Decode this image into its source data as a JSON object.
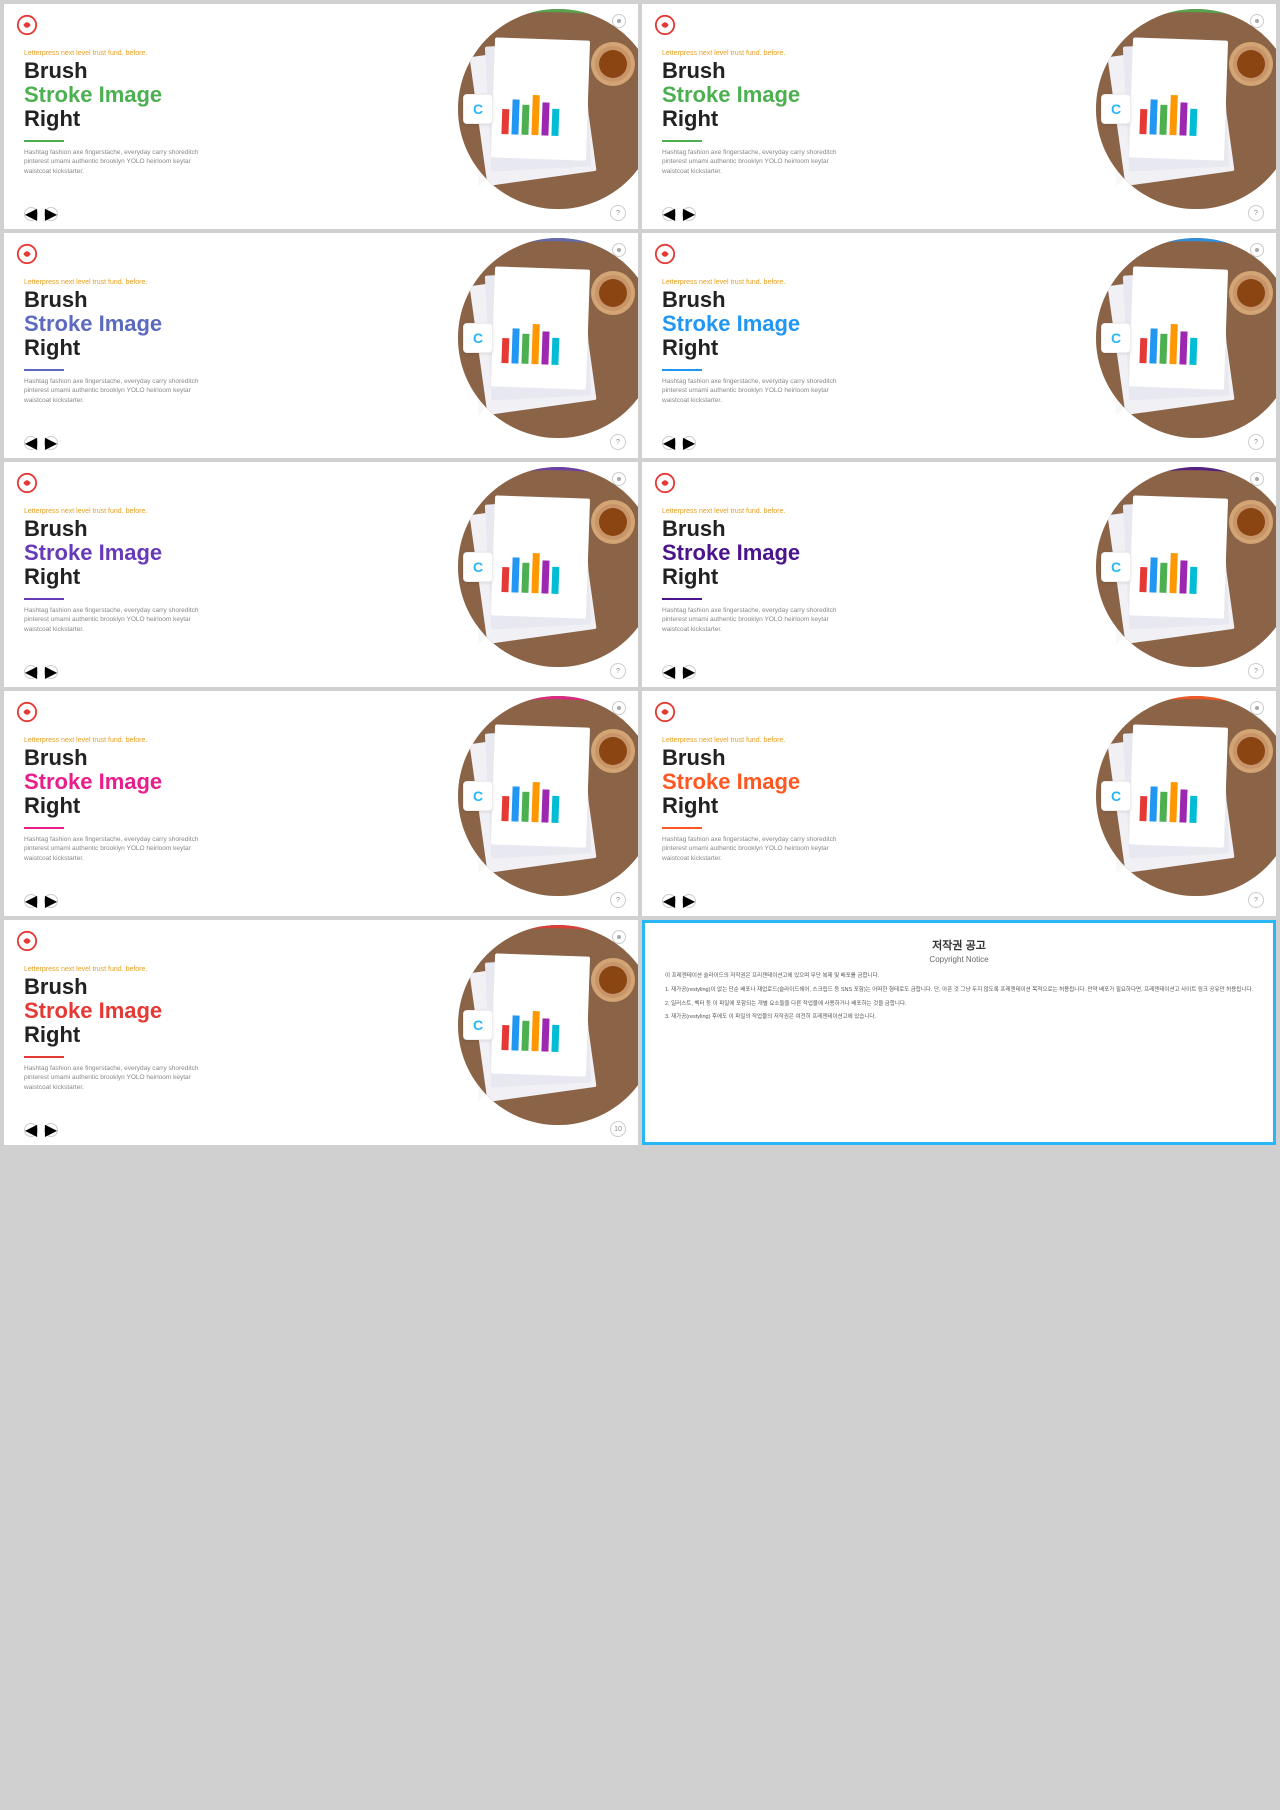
{
  "slides": [
    {
      "id": 1,
      "strokeColor": "green",
      "strokeHex": "#4caf50",
      "dividerColor": "divider-green",
      "pageNum": "?"
    },
    {
      "id": 2,
      "strokeColor": "green",
      "strokeHex": "#4caf50",
      "dividerColor": "divider-green",
      "pageNum": "?"
    },
    {
      "id": 3,
      "strokeColor": "blue",
      "strokeHex": "#5c6bc0",
      "dividerColor": "divider-blue",
      "pageNum": "?"
    },
    {
      "id": 4,
      "strokeColor": "blue",
      "strokeHex": "#2196f3",
      "dividerColor": "divider-blue",
      "pageNum": "?"
    },
    {
      "id": 5,
      "strokeColor": "purple",
      "strokeHex": "#673ab7",
      "dividerColor": "divider-purple",
      "pageNum": "?"
    },
    {
      "id": 6,
      "strokeColor": "darkpurple",
      "strokeHex": "#4a148c",
      "dividerColor": "divider-darkpurple",
      "pageNum": "?"
    },
    {
      "id": 7,
      "strokeColor": "pink",
      "strokeHex": "#e91e8c",
      "dividerColor": "divider-pink",
      "pageNum": "?"
    },
    {
      "id": 8,
      "strokeColor": "orange",
      "strokeHex": "#ff5722",
      "dividerColor": "divider-orange",
      "pageNum": "?"
    },
    {
      "id": 9,
      "strokeColor": "red",
      "strokeHex": "#e53935",
      "dividerColor": "divider-red",
      "pageNum": "10"
    }
  ],
  "slide_text": {
    "subtitle": "Letterpress next level trust fund.",
    "subtitle_highlight": "before.",
    "title_line1": "Brush",
    "title_line2": "Stroke Image",
    "title_line3": "Right",
    "body": "Hashtag fashion axe fingerstache, everyday carry shoreditch pinterest umami authentic brooklyn YOLO heirloom keytar waistcoat kickstarter."
  },
  "copyright": {
    "title": "저작권 공고",
    "subtitle": "Copyright Notice",
    "paragraphs": [
      "이 프레젠테이션 슬라이드의 저작권은 프리젠테이션고에 있으며 무단 복제 및 배포를 금합니다.",
      "1. 재가공(restyling)이 없는 단순 배포나 재업로드(슬라이드쉐어, 스크립드 등 SNS 포함)는 어떠한 형태로도 금합니다. 단, 아픈 것 그냥 두지 않도록 프레젠테이션 목적으로는 허용됩니다. 만약 배포가 필요하다면, 프레젠테이션고 사이트 링크 공유만 허용됩니다.",
      "2. 일러스트, 벡터 등 이 파일에 포함되는 개별 요소들을 다른 작업물에 사용하거나 배포하는 것을 금합니다.",
      "3. 재가공(restyling) 후에도 이 파일의 작업물의 저작권은 여전히 프레젠테이션고에 있습니다."
    ]
  }
}
